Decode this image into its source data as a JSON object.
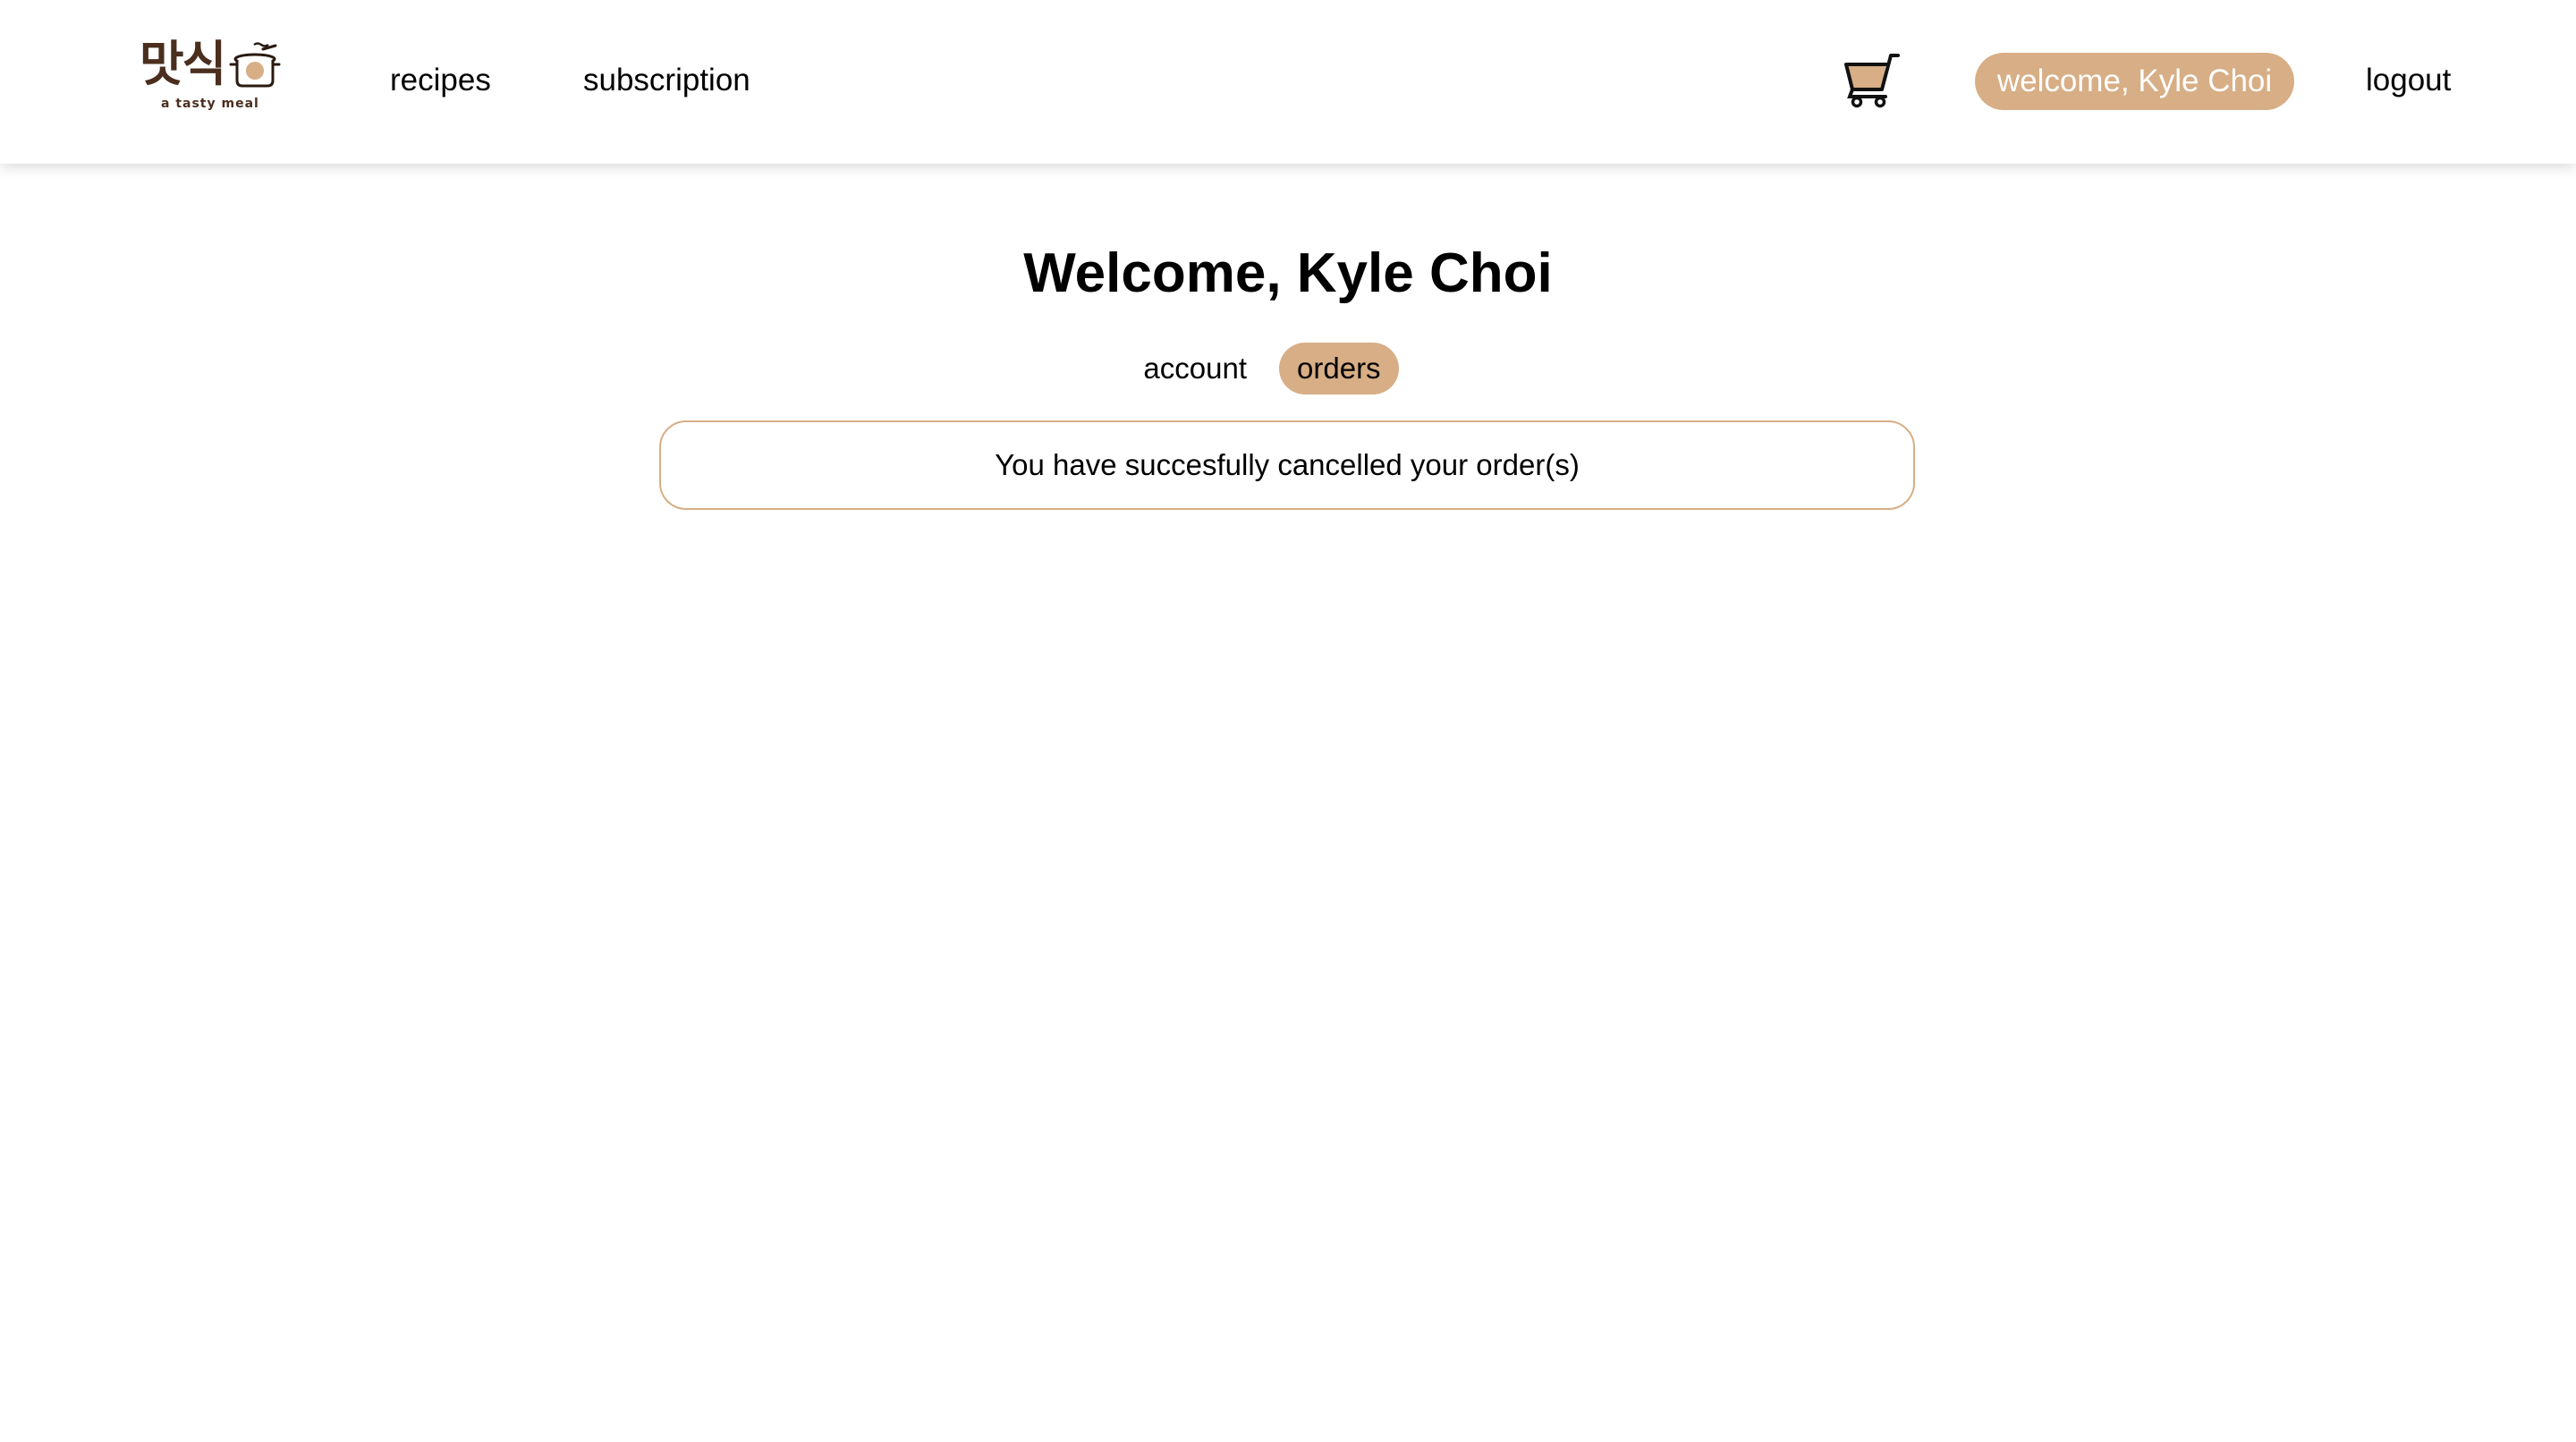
{
  "logo": {
    "korean_text": "맛식",
    "tagline": "a tasty meal",
    "pot_icon": "cooking-pot-icon"
  },
  "nav": {
    "links": [
      {
        "label": "recipes"
      },
      {
        "label": "subscription"
      }
    ],
    "cart_icon": "shopping-cart-icon",
    "welcome_label": "welcome, Kyle Choi",
    "logout_label": "logout"
  },
  "main": {
    "title": "Welcome, Kyle Choi",
    "tabs": [
      {
        "label": "account",
        "active": false
      },
      {
        "label": "orders",
        "active": true
      }
    ],
    "message": "You have succesfully cancelled your order(s)"
  },
  "colors": {
    "accent": "#d7ae85",
    "logo_brown": "#4a2e1e"
  }
}
